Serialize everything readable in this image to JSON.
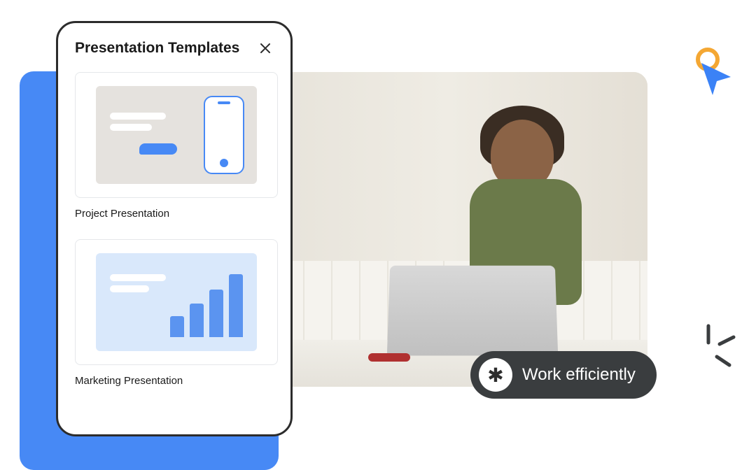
{
  "panel": {
    "title": "Presentation Templates",
    "templates": [
      {
        "label": "Project Presentation"
      },
      {
        "label": "Marketing Presentation"
      }
    ]
  },
  "badge": {
    "text": "Work efficiently",
    "icon_glyph": "✱"
  }
}
